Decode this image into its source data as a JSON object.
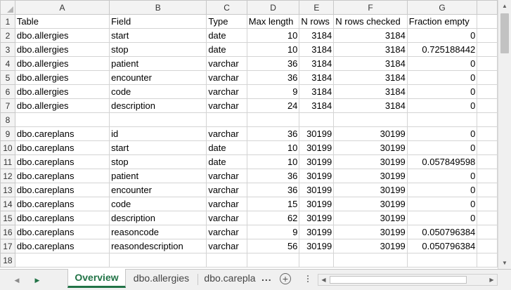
{
  "columns": [
    "A",
    "B",
    "C",
    "D",
    "E",
    "F",
    "G"
  ],
  "rows": [
    {
      "n": "1",
      "a": "Table",
      "b": "Field",
      "c": "Type",
      "d": "Max length",
      "e": "N rows",
      "f": "N rows checked",
      "g": "Fraction empty",
      "header": true
    },
    {
      "n": "2",
      "a": "dbo.allergies",
      "b": "start",
      "c": "date",
      "d": "10",
      "e": "3184",
      "f": "3184",
      "g": "0"
    },
    {
      "n": "3",
      "a": "dbo.allergies",
      "b": "stop",
      "c": "date",
      "d": "10",
      "e": "3184",
      "f": "3184",
      "g": "0.725188442"
    },
    {
      "n": "4",
      "a": "dbo.allergies",
      "b": "patient",
      "c": "varchar",
      "d": "36",
      "e": "3184",
      "f": "3184",
      "g": "0"
    },
    {
      "n": "5",
      "a": "dbo.allergies",
      "b": "encounter",
      "c": "varchar",
      "d": "36",
      "e": "3184",
      "f": "3184",
      "g": "0"
    },
    {
      "n": "6",
      "a": "dbo.allergies",
      "b": "code",
      "c": "varchar",
      "d": "9",
      "e": "3184",
      "f": "3184",
      "g": "0"
    },
    {
      "n": "7",
      "a": "dbo.allergies",
      "b": "description",
      "c": "varchar",
      "d": "24",
      "e": "3184",
      "f": "3184",
      "g": "0"
    },
    {
      "n": "8",
      "a": "",
      "b": "",
      "c": "",
      "d": "",
      "e": "",
      "f": "",
      "g": ""
    },
    {
      "n": "9",
      "a": "dbo.careplans",
      "b": "id",
      "c": "varchar",
      "d": "36",
      "e": "30199",
      "f": "30199",
      "g": "0"
    },
    {
      "n": "10",
      "a": "dbo.careplans",
      "b": "start",
      "c": "date",
      "d": "10",
      "e": "30199",
      "f": "30199",
      "g": "0"
    },
    {
      "n": "11",
      "a": "dbo.careplans",
      "b": "stop",
      "c": "date",
      "d": "10",
      "e": "30199",
      "f": "30199",
      "g": "0.057849598"
    },
    {
      "n": "12",
      "a": "dbo.careplans",
      "b": "patient",
      "c": "varchar",
      "d": "36",
      "e": "30199",
      "f": "30199",
      "g": "0"
    },
    {
      "n": "13",
      "a": "dbo.careplans",
      "b": "encounter",
      "c": "varchar",
      "d": "36",
      "e": "30199",
      "f": "30199",
      "g": "0"
    },
    {
      "n": "14",
      "a": "dbo.careplans",
      "b": "code",
      "c": "varchar",
      "d": "15",
      "e": "30199",
      "f": "30199",
      "g": "0"
    },
    {
      "n": "15",
      "a": "dbo.careplans",
      "b": "description",
      "c": "varchar",
      "d": "62",
      "e": "30199",
      "f": "30199",
      "g": "0"
    },
    {
      "n": "16",
      "a": "dbo.careplans",
      "b": "reasoncode",
      "c": "varchar",
      "d": "9",
      "e": "30199",
      "f": "30199",
      "g": "0.050796384"
    },
    {
      "n": "17",
      "a": "dbo.careplans",
      "b": "reasondescription",
      "c": "varchar",
      "d": "56",
      "e": "30199",
      "f": "30199",
      "g": "0.050796384"
    },
    {
      "n": "18",
      "a": "",
      "b": "",
      "c": "",
      "d": "",
      "e": "",
      "f": "",
      "g": ""
    }
  ],
  "tabs": {
    "overview": "Overview",
    "allergies": "dbo.allergies",
    "careplans": "dbo.carepla",
    "more": "...",
    "add": "+"
  },
  "icons": {
    "prev_sheet": "triangle-left-icon",
    "next_sheet": "triangle-right-icon",
    "add_sheet": "plus-circle-icon",
    "scroll_up": "arrow-up-icon",
    "scroll_down": "arrow-down-icon",
    "scroll_left": "arrow-left-icon",
    "scroll_right": "arrow-right-icon"
  },
  "colors": {
    "accent": "#217346",
    "header_bg": "#f3f3f3",
    "gridline": "#d4d4d4"
  }
}
